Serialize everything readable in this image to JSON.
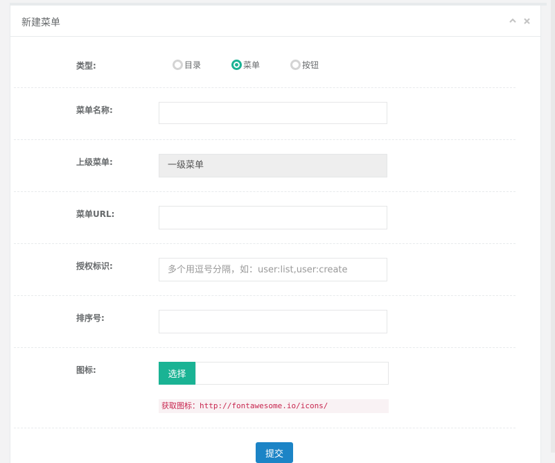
{
  "panel": {
    "title": "新建菜单"
  },
  "icons": {
    "collapse": "chevron-up-icon",
    "close": "close-icon"
  },
  "form": {
    "type": {
      "label": "类型:",
      "options": [
        {
          "label": "目录",
          "selected": false
        },
        {
          "label": "菜单",
          "selected": true
        },
        {
          "label": "按钮",
          "selected": false
        }
      ]
    },
    "menu_name": {
      "label": "菜单名称:",
      "value": ""
    },
    "parent_menu": {
      "label": "上级菜单:",
      "value": "一级菜单"
    },
    "menu_url": {
      "label": "菜单URL:",
      "value": ""
    },
    "permission": {
      "label": "授权标识:",
      "placeholder": "多个用逗号分隔，如：user:list,user:create"
    },
    "order": {
      "label": "排序号:",
      "value": ""
    },
    "icon": {
      "label": "图标:",
      "select_button": "选择",
      "value": "",
      "hint": "获取图标：http://fontawesome.io/icons/"
    },
    "submit_label": "提交"
  },
  "colors": {
    "accent": "#1ab394",
    "primary": "#1c84c6",
    "hint_text": "#c7254e"
  }
}
